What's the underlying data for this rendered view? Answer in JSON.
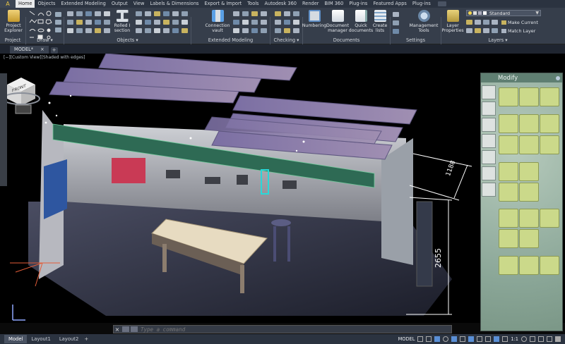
{
  "app_button": "A",
  "ribbon_tabs": [
    "Home",
    "Objects",
    "Extended Modeling",
    "Output",
    "View",
    "Labels & Dimensions",
    "Export & Import",
    "Tools",
    "Autodesk 360",
    "Render",
    "BIM 360",
    "Plug-ins",
    "Featured Apps",
    "Plug-ins"
  ],
  "ribbon_buttons": {
    "project_explorer": "Project Explorer",
    "rolled_i_section": "Rolled I section",
    "connection_vault": "Connection vault",
    "numbering": "Numbering",
    "document_manager": "Document manager",
    "quick_documents": "Quick documents",
    "create_lists": "Create lists",
    "management_tools": "Management Tools",
    "layer_properties": "Layer Properties",
    "make_current": "Make Current",
    "match_layer": "Match Layer"
  },
  "layer_dropdown_value": "Standard",
  "ribbon_panels": {
    "project": "Project",
    "draw": "Draw ▾",
    "objects": "Objects ▾",
    "extended_modeling": "Extended Modeling",
    "checking": "Checking ▾",
    "documents": "Documents",
    "settings": "Settings",
    "layers": "Layers ▾"
  },
  "document_tab": "MODEL*",
  "document_tab_close": "×",
  "document_tab_add": "+",
  "viewport_label": "[−][Custom View][Shaded with edges]",
  "viewcube_face": "FRONT",
  "dimensions": {
    "top": "1188",
    "side": "2655"
  },
  "command_placeholder": "Type a command",
  "status_tabs": [
    "Model",
    "Layout1",
    "Layout2"
  ],
  "status_model": "MODEL",
  "status_scale": "1:1",
  "palette_title": "Modify",
  "colors": {
    "ribbon_bg": "#363e4b",
    "palette_green": "#cbd98a",
    "beam_green": "#2e6a54",
    "dimension_white": "#ffffff",
    "active_tab": "#e9eaec"
  }
}
